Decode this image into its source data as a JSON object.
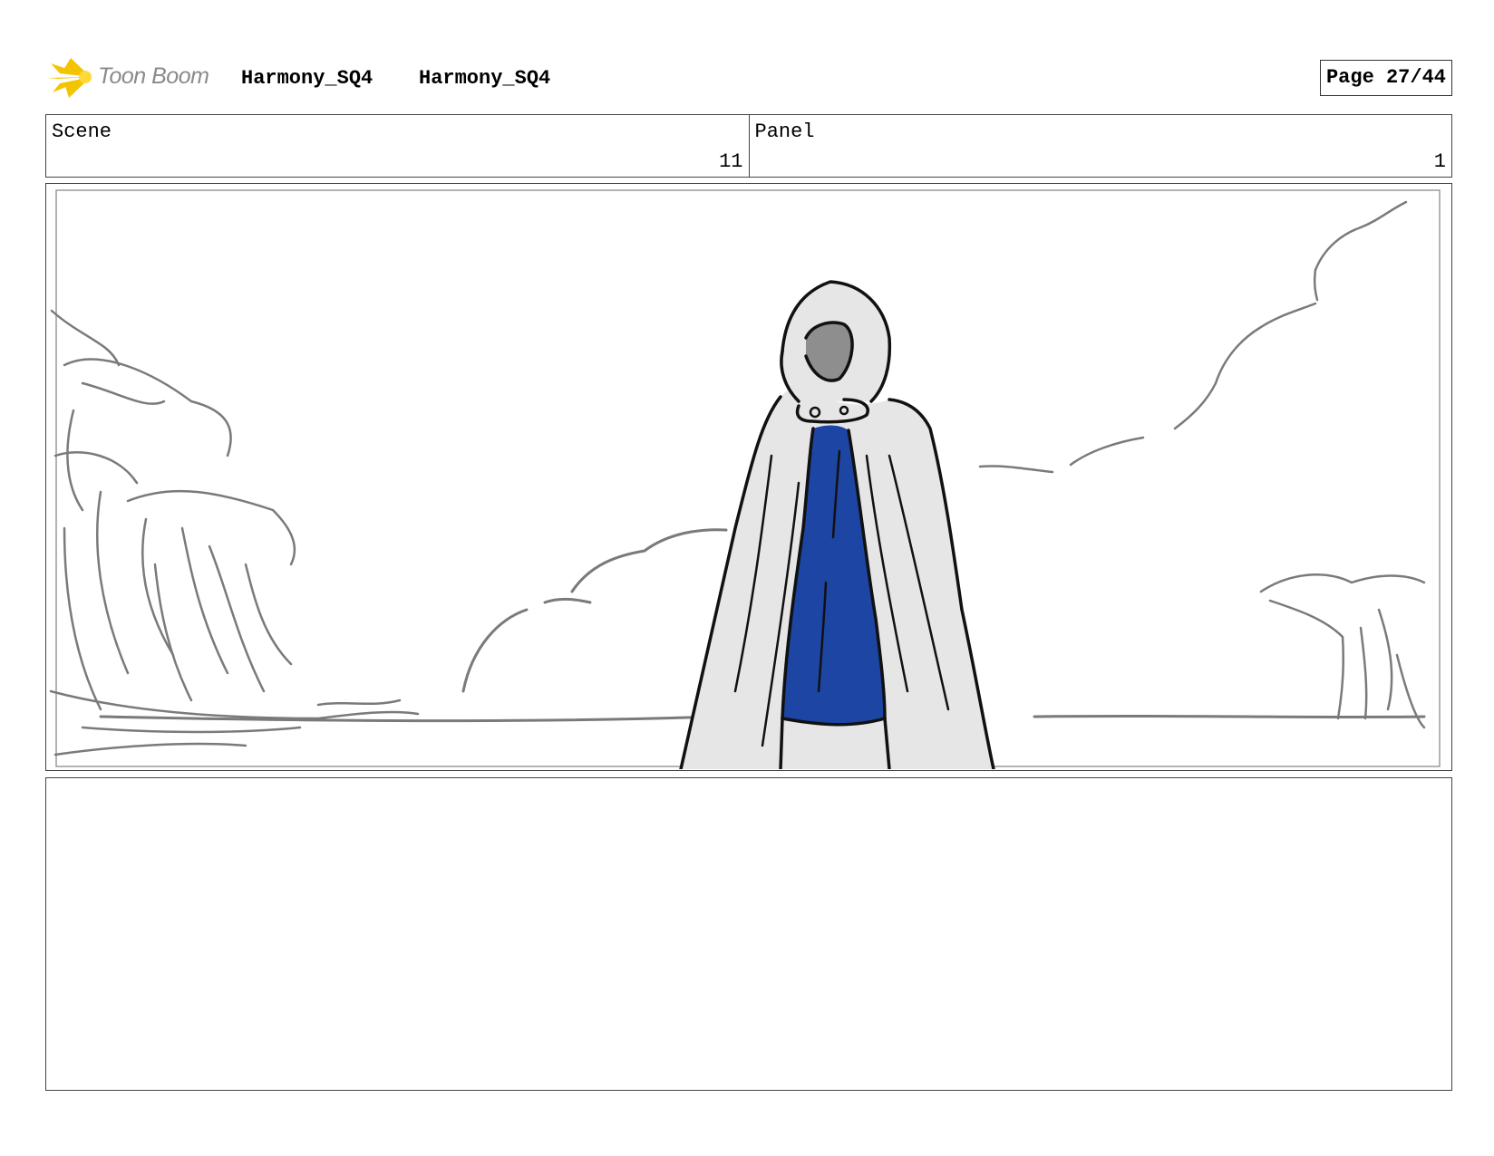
{
  "header": {
    "logo_text": "Toon Boom",
    "project_name": "Harmony_SQ4",
    "sequence_name": "Harmony_SQ4",
    "page_label": "Page 27/44"
  },
  "info": {
    "scene_label": "Scene",
    "scene_value": "11",
    "panel_label": "Panel",
    "panel_value": "1"
  },
  "colors": {
    "logo_star": "#f5c400",
    "cloak_fill": "#e6e6e6",
    "robe_fill": "#1d45a3",
    "sketch_gray": "#7a7a7a",
    "line_dark": "#111111"
  },
  "notes": {
    "text": ""
  }
}
